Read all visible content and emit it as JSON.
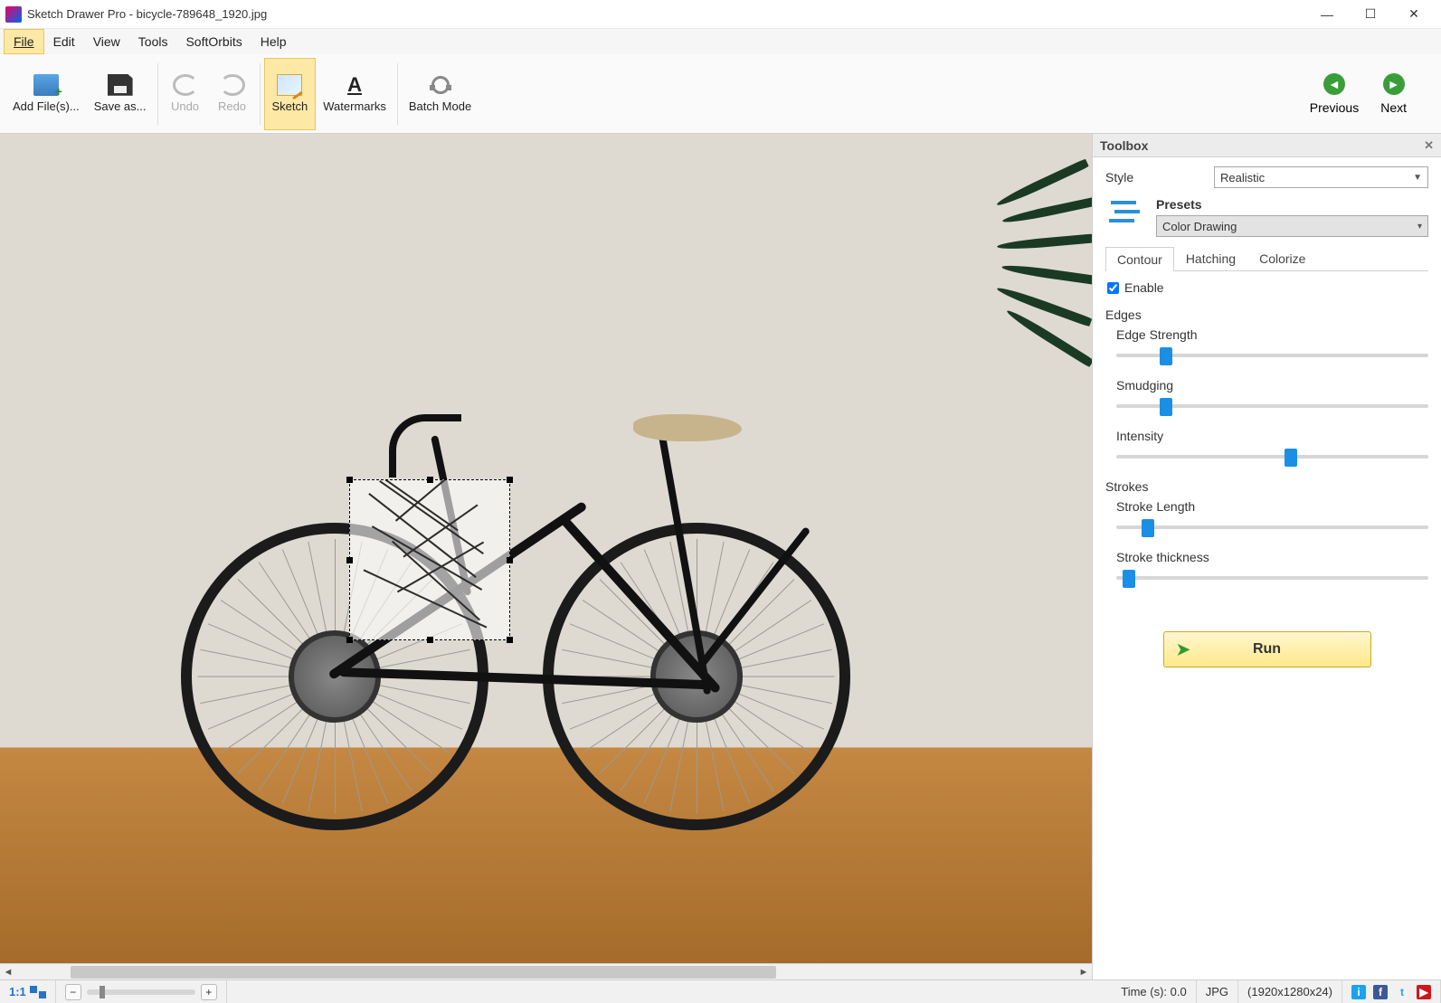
{
  "title": "Sketch Drawer Pro - bicycle-789648_1920.jpg",
  "menu": {
    "file": "File",
    "edit": "Edit",
    "view": "View",
    "tools": "Tools",
    "softorbits": "SoftOrbits",
    "help": "Help"
  },
  "toolbar": {
    "add": "Add File(s)...",
    "save": "Save as...",
    "undo": "Undo",
    "redo": "Redo",
    "sketch": "Sketch",
    "watermarks": "Watermarks",
    "batch": "Batch Mode",
    "previous": "Previous",
    "next": "Next"
  },
  "toolbox": {
    "title": "Toolbox",
    "style_label": "Style",
    "style_value": "Realistic",
    "presets_label": "Presets",
    "presets_value": "Color Drawing",
    "tabs": {
      "contour": "Contour",
      "hatching": "Hatching",
      "colorize": "Colorize"
    },
    "enable": "Enable",
    "edges_label": "Edges",
    "sliders": {
      "edge_strength": {
        "label": "Edge Strength",
        "pos": 14
      },
      "smudging": {
        "label": "Smudging",
        "pos": 14
      },
      "intensity": {
        "label": "Intensity",
        "pos": 54
      }
    },
    "strokes_label": "Strokes",
    "strokes": {
      "stroke_length": {
        "label": "Stroke Length",
        "pos": 8
      },
      "stroke_thickness": {
        "label": "Stroke thickness",
        "pos": 2
      }
    },
    "run": "Run"
  },
  "status": {
    "ratio": "1:1",
    "time": "Time (s): 0.0",
    "format": "JPG",
    "dims": "(1920x1280x24)"
  }
}
